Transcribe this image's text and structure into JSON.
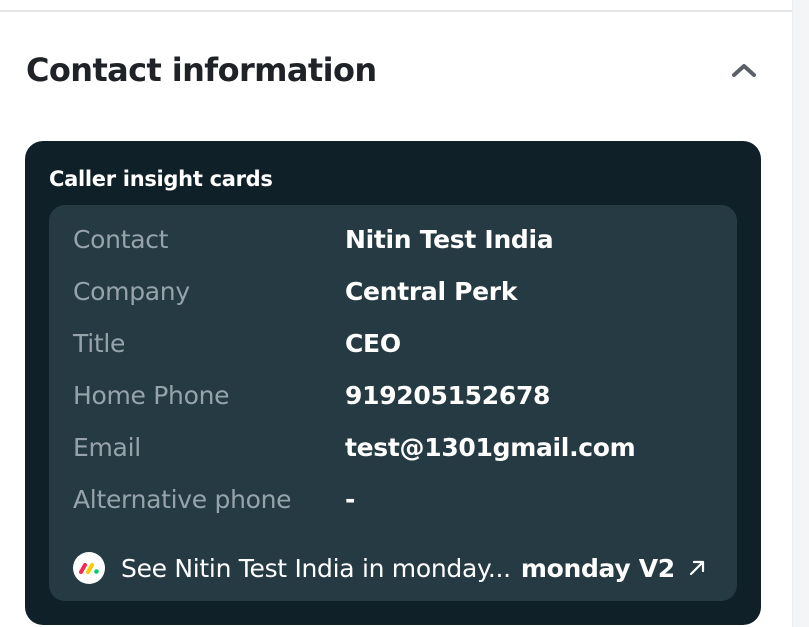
{
  "section": {
    "title": "Contact information"
  },
  "card": {
    "title": "Caller insight cards",
    "rows": [
      {
        "label": "Contact",
        "value": "Nitin Test India"
      },
      {
        "label": "Company",
        "value": "Central Perk"
      },
      {
        "label": "Title",
        "value": "CEO"
      },
      {
        "label": "Home Phone",
        "value": "919205152678"
      },
      {
        "label": "Email",
        "value": "test@1301gmail.com"
      },
      {
        "label": "Alternative phone",
        "value": "-"
      }
    ],
    "link": {
      "text": "See Nitin Test India in monday...",
      "app": "monday V2"
    }
  },
  "icons": {
    "collapse": "chevron-up-icon",
    "logo": "monday-logo-icon",
    "external": "external-link-icon"
  },
  "colors": {
    "card_bg": "#0f2029",
    "inner_bg": "#263a44",
    "label": "#97a3ab",
    "value": "#ffffff",
    "title": "#1f2328",
    "monday_red": "#f62b54",
    "monday_yellow": "#ffcc00",
    "monday_green": "#00ca72"
  }
}
